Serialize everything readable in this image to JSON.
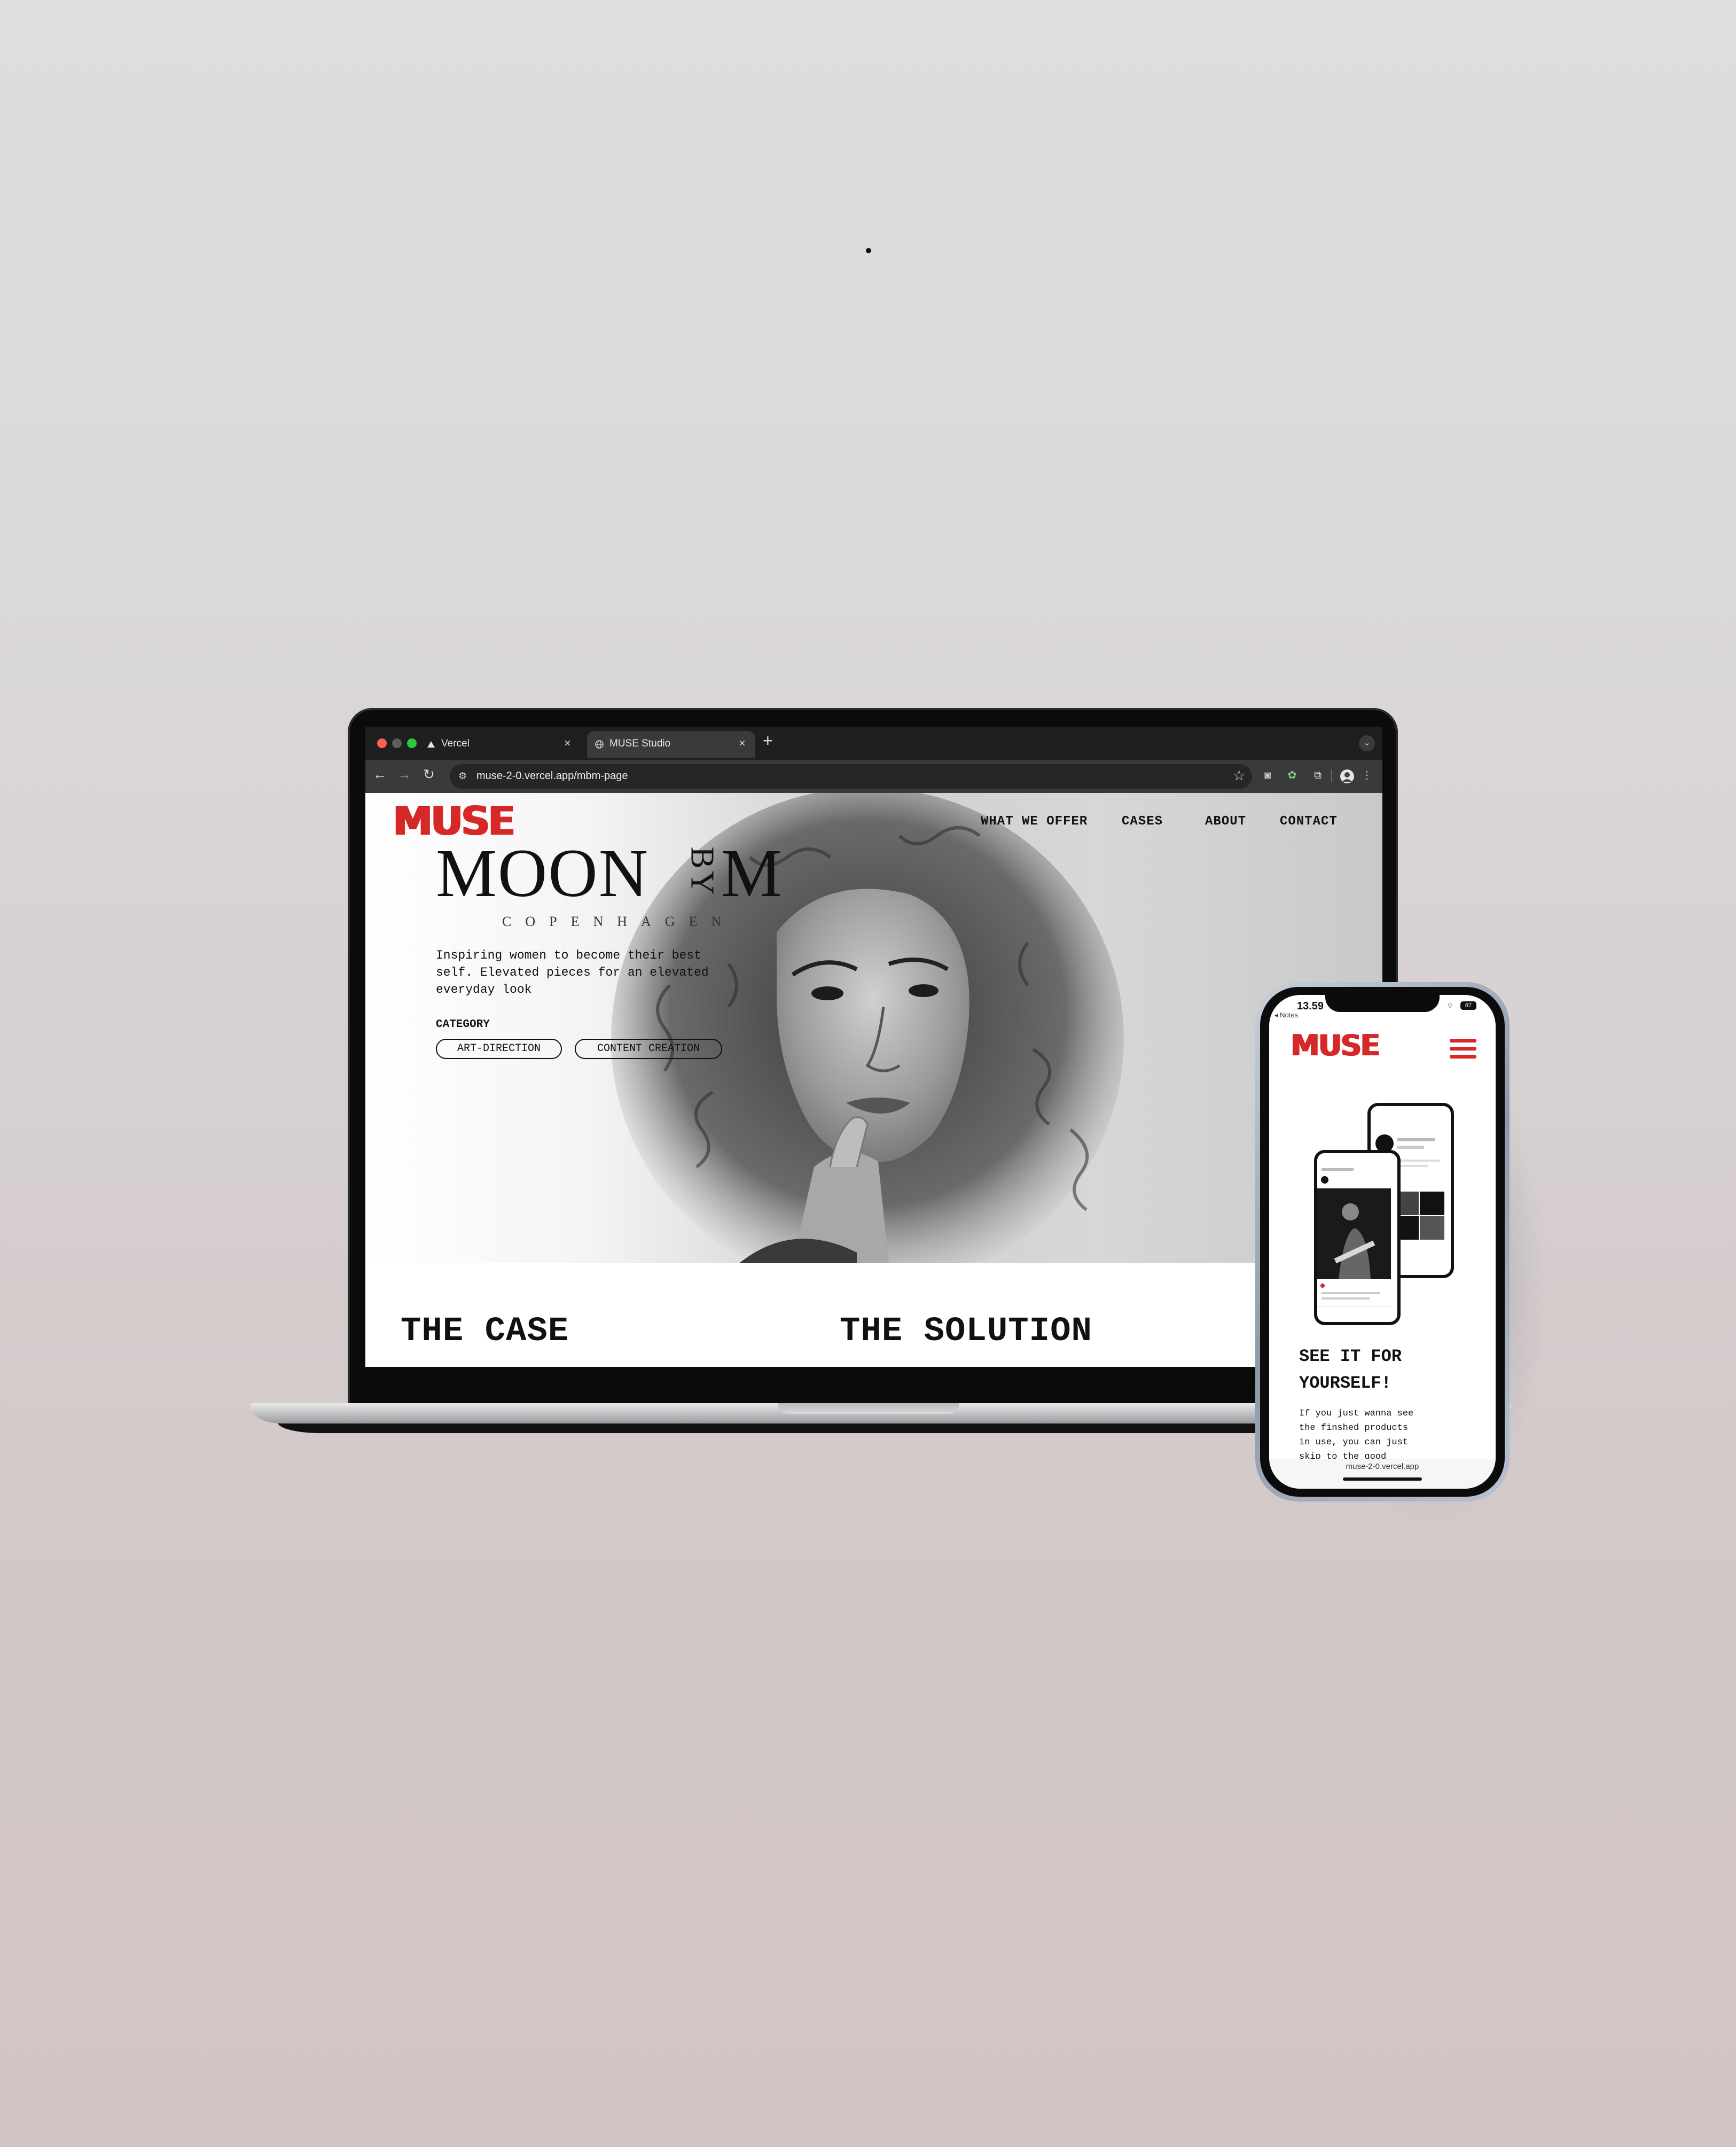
{
  "browser": {
    "tabs": [
      {
        "label": "Vercel",
        "active": false
      },
      {
        "label": "MUSE Studio",
        "active": true
      }
    ],
    "new_tab": "+",
    "url": "muse-2-0.vercel.app/mbm-page"
  },
  "site": {
    "logo": "MUSE",
    "nav": [
      "WHAT WE OFFER",
      "CASES",
      "ABOUT",
      "CONTACT"
    ],
    "brand": {
      "moon": "MOON",
      "by": "BY",
      "m": "M",
      "city": "COPENHAGEN"
    },
    "tagline": "Inspiring women to become their best self. Elevated pieces for an elevated everyday look",
    "category_label": "CATEGORY",
    "categories": [
      "ART-DIRECTION",
      "CONTENT CREATION"
    ],
    "sections": {
      "case": "THE CASE",
      "solution": "THE SOLUTION"
    }
  },
  "phone": {
    "time": "13.59",
    "back_label": "◂ Notes",
    "battery": "87",
    "logo": "MUSE",
    "title": "SEE IT FOR\nYOURSELF!",
    "body": "If you just wanna see\nthe finshed products\nin use, you can just\nskip to the good",
    "url": "muse-2-0.vercel.app"
  },
  "colors": {
    "accent": "#d62828",
    "ink": "#111111",
    "background": "#dad6d6"
  },
  "icons": [
    "back-arrow-icon",
    "forward-arrow-icon",
    "reload-icon",
    "site-info-icon",
    "bookmark-star-icon",
    "extensions-icon",
    "profile-icon",
    "menu-dots-icon",
    "hamburger-menu-icon",
    "lock-icon"
  ]
}
